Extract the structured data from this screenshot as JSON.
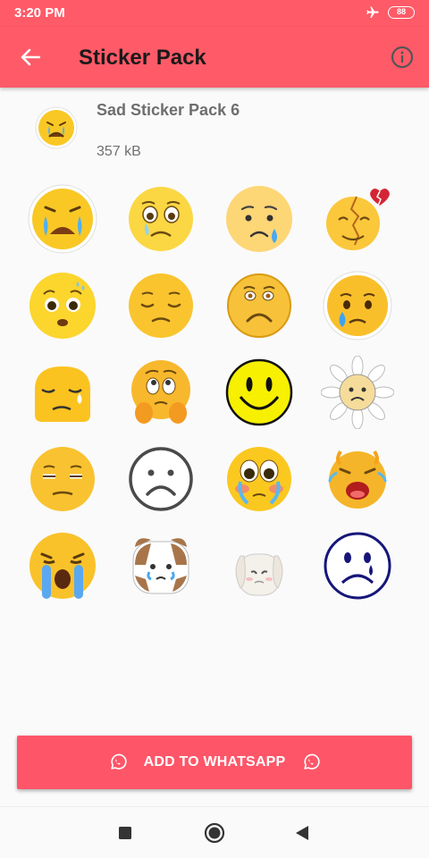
{
  "status_bar": {
    "time": "3:20 PM",
    "battery": "88",
    "icons": [
      "airplane-mode-icon",
      "battery-icon"
    ]
  },
  "app_bar": {
    "title": "Sticker Pack",
    "back_icon": "arrow-left-icon",
    "info_icon": "info-circle-icon"
  },
  "pack": {
    "name": "Sad Sticker Pack 6",
    "size": "357 kB",
    "tray_icon": "crying-face-icon"
  },
  "stickers": [
    {
      "icon": "crying-tears-face-sticker"
    },
    {
      "icon": "pleading-teary-face-sticker"
    },
    {
      "icon": "sad-face-with-tear-sticker"
    },
    {
      "icon": "cracked-face-broken-heart-sticker"
    },
    {
      "icon": "anxious-face-sticker"
    },
    {
      "icon": "pensive-face-sticker"
    },
    {
      "icon": "frowning-face-sticker"
    },
    {
      "icon": "crying-teardrop-face-sticker"
    },
    {
      "icon": "sleepy-tear-face-sticker"
    },
    {
      "icon": "worried-face-hands-sticker"
    },
    {
      "icon": "classic-smiley-sticker"
    },
    {
      "icon": "daisy-sad-face-sticker"
    },
    {
      "icon": "unamused-face-sticker"
    },
    {
      "icon": "outline-sad-face-sticker"
    },
    {
      "icon": "sobbing-blushing-face-sticker"
    },
    {
      "icon": "screaming-crying-face-sticker"
    },
    {
      "icon": "loudly-crying-face-sticker"
    },
    {
      "icon": "crying-hamster-sticker"
    },
    {
      "icon": "crying-bunny-sticker"
    },
    {
      "icon": "blue-sad-face-tear-sticker"
    }
  ],
  "add_button": {
    "label": "ADD TO WHATSAPP",
    "icon": "whatsapp-icon"
  },
  "nav": {
    "recents": "square-icon",
    "home": "circle-icon",
    "back": "triangle-back-icon"
  },
  "colors": {
    "accent": "#ff5a68",
    "button": "#ff5568",
    "emoji_yellow": "#f9c825"
  }
}
